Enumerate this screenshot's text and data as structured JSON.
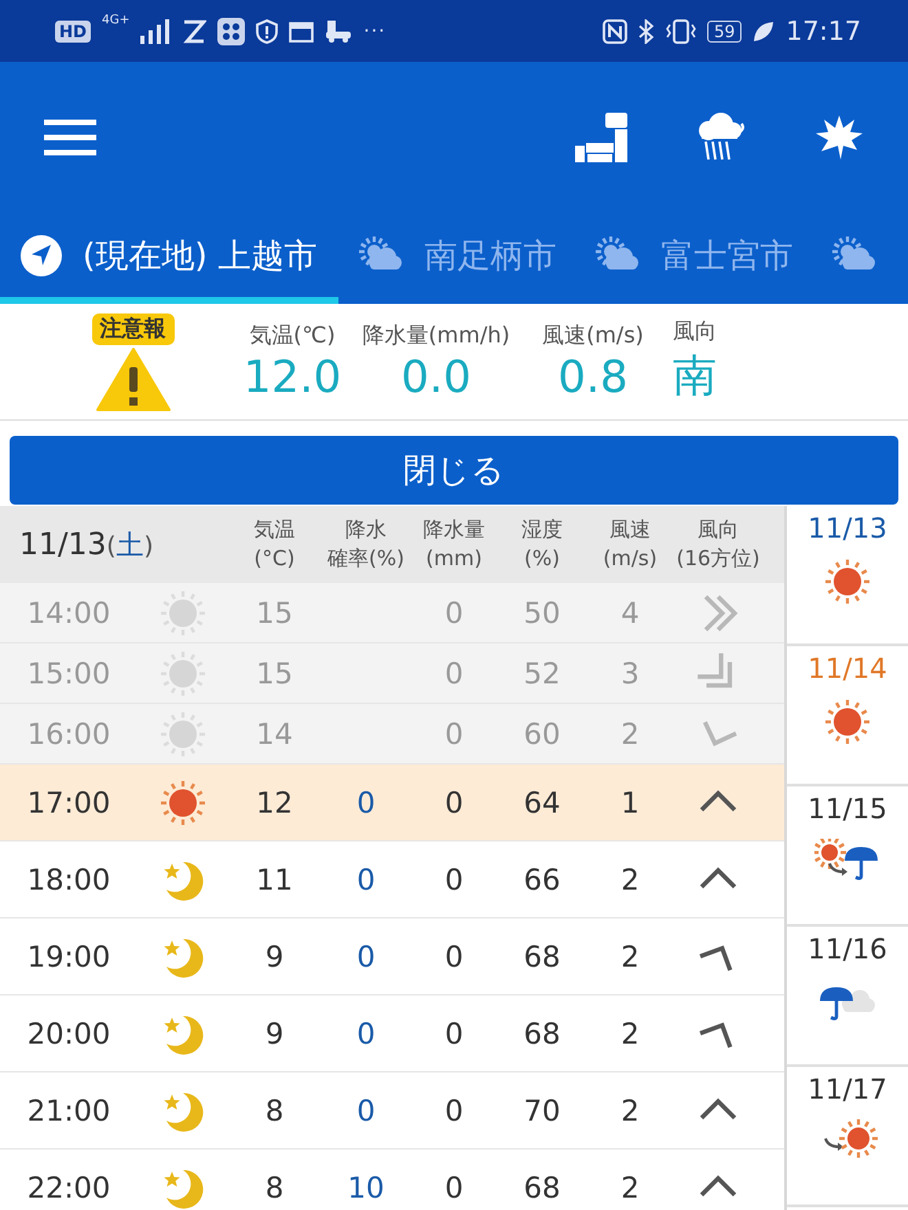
{
  "status_bar": {
    "network": "HD",
    "network_type": "4G+",
    "more": "···",
    "battery": "59",
    "time": "17:17"
  },
  "tabs": [
    {
      "kind": "location",
      "label": "(現在地) 上越市",
      "selected": true
    },
    {
      "kind": "cloudy",
      "label": "南足柄市",
      "selected": false
    },
    {
      "kind": "cloudy",
      "label": "富士宮市",
      "selected": false
    },
    {
      "kind": "cloudy",
      "selected": false
    }
  ],
  "current": {
    "alert": "注意報",
    "metrics": [
      {
        "label": "気温(℃)",
        "value": "12.0"
      },
      {
        "label": "降水量(mm/h)",
        "value": "0.0"
      },
      {
        "label": "風速(m/s)",
        "value": "0.8"
      },
      {
        "label": "風向",
        "value": "南"
      }
    ]
  },
  "close_button": "閉じる",
  "table": {
    "date": "11/13",
    "weekday_open": "(",
    "weekday": "土",
    "weekday_close": ")",
    "columns": [
      [
        "気温",
        "(°C)"
      ],
      [
        "降水",
        "確率(%)"
      ],
      [
        "降水量",
        "(mm)"
      ],
      [
        "湿度",
        "(%)"
      ],
      [
        "風速",
        "(m/s)"
      ],
      [
        "風向",
        "(16方位)"
      ]
    ],
    "rows": [
      {
        "time": "14:00",
        "past": true,
        "selected": false,
        "kind": "sun",
        "temp": "15",
        "rain": "0",
        "humidity": "50",
        "wind": "4",
        "wind_arrow": {
          "kind": "west",
          "double": true
        }
      },
      {
        "time": "15:00",
        "past": true,
        "selected": false,
        "kind": "sun",
        "temp": "15",
        "rain": "0",
        "humidity": "52",
        "wind": "3",
        "wind_arrow": {
          "kind": "northwest",
          "double": true
        }
      },
      {
        "time": "16:00",
        "past": true,
        "selected": false,
        "kind": "sun",
        "temp": "14",
        "rain": "0",
        "humidity": "60",
        "wind": "2",
        "wind_arrow": {
          "kind": "north",
          "double": false
        }
      },
      {
        "time": "17:00",
        "past": false,
        "selected": true,
        "kind": "sun",
        "temp": "12",
        "probability": "0",
        "rain": "0",
        "humidity": "64",
        "wind": "1",
        "wind_arrow": {
          "kind": "south",
          "double": false
        }
      },
      {
        "time": "18:00",
        "past": false,
        "selected": false,
        "kind": "moon",
        "temp": "11",
        "probability": "0",
        "rain": "0",
        "humidity": "66",
        "wind": "2",
        "wind_arrow": {
          "kind": "south",
          "double": false
        }
      },
      {
        "time": "19:00",
        "past": false,
        "selected": false,
        "kind": "moon",
        "temp": "9",
        "probability": "0",
        "rain": "0",
        "humidity": "68",
        "wind": "2",
        "wind_arrow": {
          "kind": "southwest",
          "double": false
        }
      },
      {
        "time": "20:00",
        "past": false,
        "selected": false,
        "kind": "moon",
        "temp": "9",
        "probability": "0",
        "rain": "0",
        "humidity": "68",
        "wind": "2",
        "wind_arrow": {
          "kind": "southwest",
          "double": false
        }
      },
      {
        "time": "21:00",
        "past": false,
        "selected": false,
        "kind": "moon",
        "temp": "8",
        "probability": "0",
        "rain": "0",
        "humidity": "70",
        "wind": "2",
        "wind_arrow": {
          "kind": "south",
          "double": false
        }
      },
      {
        "time": "22:00",
        "past": false,
        "selected": false,
        "kind": "moon",
        "temp": "8",
        "probability": "10",
        "rain": "0",
        "humidity": "68",
        "wind": "2",
        "wind_arrow": {
          "kind": "south",
          "double": false
        }
      }
    ]
  },
  "days": [
    {
      "date": "11/13",
      "color": "#1a5aa8",
      "kind": "sun"
    },
    {
      "date": "11/14",
      "color": "#e07828",
      "kind": "sun"
    },
    {
      "date": "11/15",
      "color": "#333333",
      "kind": "clearing"
    },
    {
      "date": "11/16",
      "color": "#333333",
      "kind": "rain"
    },
    {
      "date": "11/17",
      "color": "#333333",
      "kind": "sunny"
    }
  ]
}
